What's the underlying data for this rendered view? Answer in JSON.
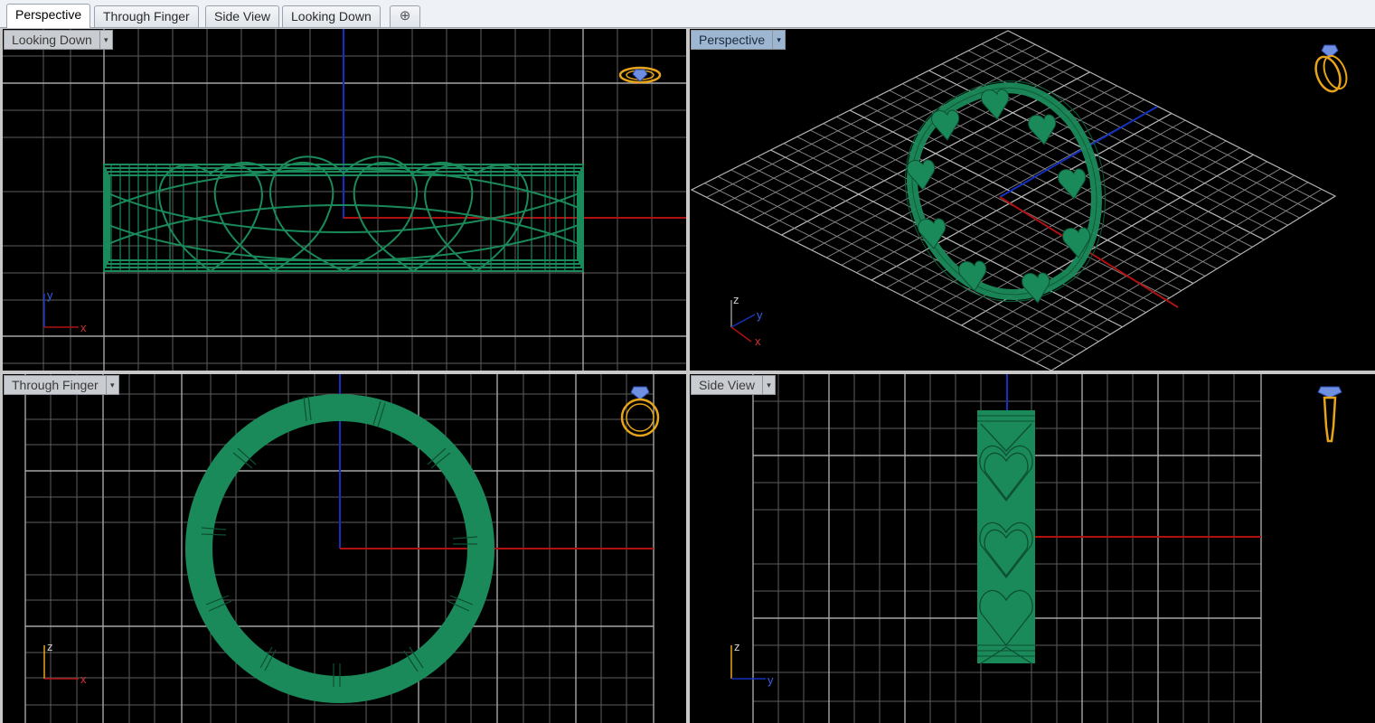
{
  "tabs": [
    {
      "label": "Perspective",
      "active": true
    },
    {
      "label": "Through Finger",
      "active": false
    },
    {
      "label": "Side View",
      "active": false
    },
    {
      "label": "Looking Down",
      "active": false
    }
  ],
  "tab_add_icon": "plus-icon",
  "viewports": {
    "top_left": {
      "title": "Looking Down",
      "axis_a": "y",
      "axis_b": "x"
    },
    "top_right": {
      "title": "Perspective",
      "axis_a": "z",
      "axis_b": "y",
      "axis_c": "x"
    },
    "bottom_left": {
      "title": "Through Finger",
      "axis_a": "z",
      "axis_b": "x"
    },
    "bottom_right": {
      "title": "Side View",
      "axis_a": "z",
      "axis_b": "y"
    }
  },
  "colors": {
    "model": "#1a8a5a",
    "x_axis": "#b01010",
    "y_axis_world": "#1230b8",
    "grid": "#6e6e6e",
    "grid_major": "#a0a0a0",
    "gem_icon": "#e8a418",
    "active_label": "#9db6d2"
  }
}
